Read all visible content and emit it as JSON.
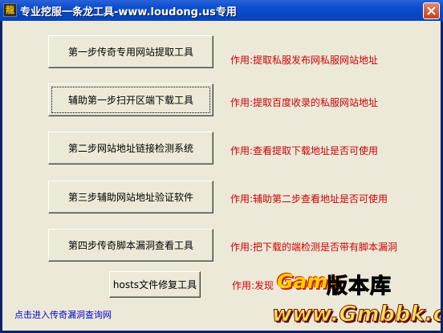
{
  "window": {
    "title": "专业挖服一条龙工具-www.loudong.us专用",
    "icon_name": "app-icon",
    "icon_glyph": "龍",
    "close_icon": "close-icon"
  },
  "tools": [
    {
      "button": "第一步传奇专用网站提取工具",
      "desc": "作用:提取私服发布网私服网站地址"
    },
    {
      "button": "辅助第一步扫开区端下载工具",
      "desc": "作用:提取百度收录的私服网站地址"
    },
    {
      "button": "第二步网站地址链接检测系统",
      "desc": "作用:查看提取下载地址是否可使用"
    },
    {
      "button": "第三步辅助网站地址验证软件",
      "desc": "作用:辅助第二步查看地址是否可使用"
    },
    {
      "button": "第四步传奇脚本漏洞查看工具",
      "desc": "作用:把下载的端检测是否带有脚本漏洞"
    },
    {
      "button": "hosts文件修复工具",
      "desc": "作用:发现"
    }
  ],
  "link_text": "点击进入传奇漏洞查询网",
  "watermark": {
    "game": "Game",
    "title": "版本库",
    "url": "www.Gmbbk.com"
  },
  "colors": {
    "titlebar": "#0a4fd0",
    "client": "#ece9d8",
    "desc_text": "#cc0000",
    "link_text": "#0000cc"
  }
}
